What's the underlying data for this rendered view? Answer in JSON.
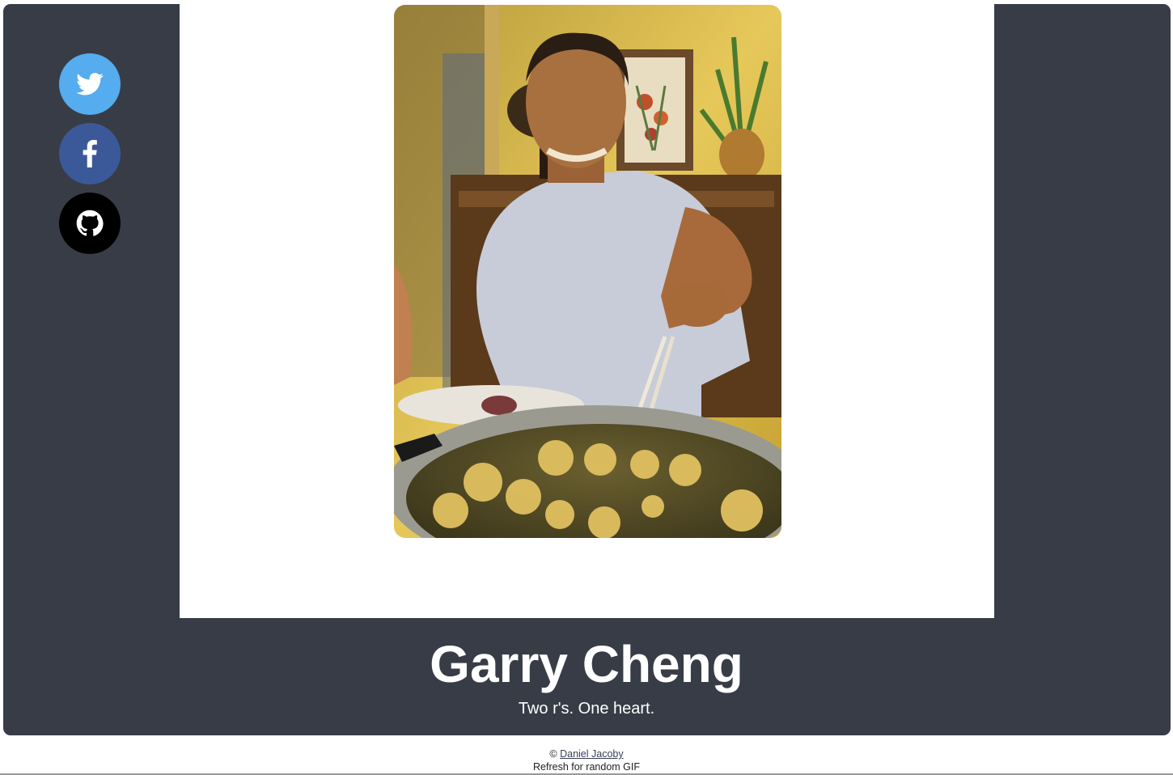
{
  "profile": {
    "name": "Garry Cheng",
    "tagline": "Two r's. One heart.",
    "photo_alt": "Garry Cheng"
  },
  "social": [
    {
      "name": "twitter",
      "icon": "twitter-icon",
      "color": "#55acee"
    },
    {
      "name": "facebook",
      "icon": "facebook-icon",
      "color": "#3b5998"
    },
    {
      "name": "github",
      "icon": "github-icon",
      "color": "#000000"
    }
  ],
  "footer": {
    "copyright_symbol": "©",
    "author_link": "Daniel Jacoby",
    "refresh_note": "Refresh for random GIF"
  },
  "colors": {
    "frame": "#383c46",
    "content": "#ffffff",
    "title": "#ffffff"
  }
}
